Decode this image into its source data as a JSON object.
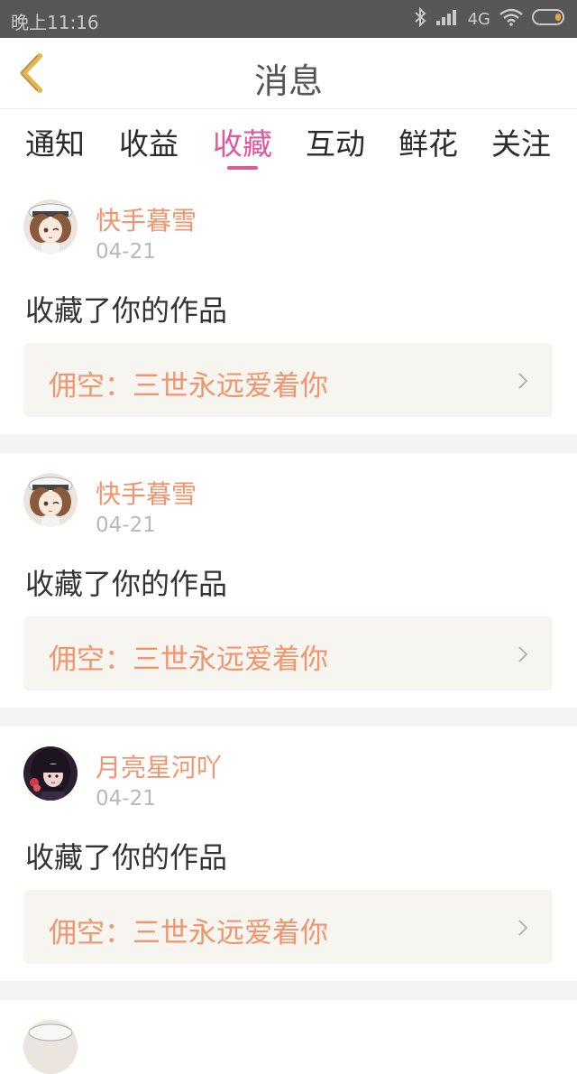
{
  "status_bar": {
    "time": "晚上11:16",
    "network": "4G"
  },
  "header": {
    "title": "消息"
  },
  "tabs": [
    {
      "label": "通知"
    },
    {
      "label": "收益"
    },
    {
      "label": "收藏",
      "active": true
    },
    {
      "label": "互动"
    },
    {
      "label": "鲜花"
    },
    {
      "label": "关注"
    }
  ],
  "feed": [
    {
      "user": "快手暮雪",
      "date": "04-21",
      "action": "收藏了你的作品",
      "work": "佣空：三世永远爱着你",
      "avatar": "anime-girl-avatar"
    },
    {
      "user": "快手暮雪",
      "date": "04-21",
      "action": "收藏了你的作品",
      "work": "佣空：三世永远爱着你",
      "avatar": "anime-girl-avatar"
    },
    {
      "user": "月亮星河吖",
      "date": "04-21",
      "action": "收藏了你的作品",
      "work": "佣空：三世永远爱着你",
      "avatar": "dark-hair-girl-avatar"
    }
  ],
  "colors": {
    "accent": "#e5579b",
    "username": "#f0956d",
    "back_arrow": "#e8b64a"
  }
}
